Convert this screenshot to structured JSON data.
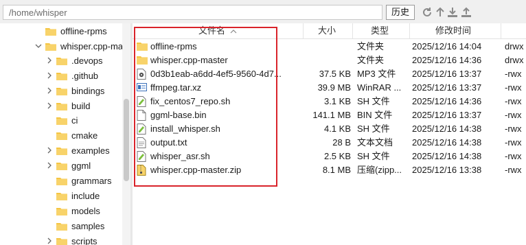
{
  "pathbar": {
    "path": "/home/whisper",
    "history_label": "历史",
    "tools": [
      "refresh-icon",
      "up-folder-icon",
      "download-icon",
      "upload-icon"
    ]
  },
  "tree": {
    "items": [
      {
        "label": "offline-rpms",
        "expanded": false,
        "has_children": false
      },
      {
        "label": "whisper.cpp-master",
        "expanded": true,
        "has_children": true
      },
      {
        "label": ".devops",
        "has_children": true
      },
      {
        "label": ".github",
        "has_children": true
      },
      {
        "label": "bindings",
        "has_children": true
      },
      {
        "label": "build",
        "has_children": true
      },
      {
        "label": "ci",
        "has_children": false
      },
      {
        "label": "cmake",
        "has_children": false
      },
      {
        "label": "examples",
        "has_children": true
      },
      {
        "label": "ggml",
        "has_children": true
      },
      {
        "label": "grammars",
        "has_children": false
      },
      {
        "label": "include",
        "has_children": false
      },
      {
        "label": "models",
        "has_children": false
      },
      {
        "label": "samples",
        "has_children": false
      },
      {
        "label": "scripts",
        "has_children": true
      }
    ]
  },
  "list": {
    "columns": {
      "name": "文件名",
      "size": "大小",
      "type": "类型",
      "modified": "修改时间"
    },
    "files": [
      {
        "name": "offline-rpms",
        "size": "",
        "type": "文件夹",
        "modified": "2025/12/16 14:04",
        "perm": "drwx",
        "icon": "folder-icon"
      },
      {
        "name": "whisper.cpp-master",
        "size": "",
        "type": "文件夹",
        "modified": "2025/12/16 14:36",
        "perm": "drwx",
        "icon": "folder-icon"
      },
      {
        "name": "0d3b1eab-a6dd-4ef5-9560-4d7...",
        "size": "37.5 KB",
        "type": "MP3 文件",
        "modified": "2025/12/16 13:37",
        "perm": "-rwx",
        "icon": "audio-file-icon"
      },
      {
        "name": "ffmpeg.tar.xz",
        "size": "39.9 MB",
        "type": "WinRAR ...",
        "modified": "2025/12/16 13:37",
        "perm": "-rwx",
        "icon": "archive-file-icon"
      },
      {
        "name": "fix_centos7_repo.sh",
        "size": "3.1 KB",
        "type": "SH 文件",
        "modified": "2025/12/16 14:36",
        "perm": "-rwx",
        "icon": "script-file-icon"
      },
      {
        "name": "ggml-base.bin",
        "size": "141.1 MB",
        "type": "BIN 文件",
        "modified": "2025/12/16 13:37",
        "perm": "-rwx",
        "icon": "blank-file-icon"
      },
      {
        "name": "install_whisper.sh",
        "size": "4.1 KB",
        "type": "SH 文件",
        "modified": "2025/12/16 14:38",
        "perm": "-rwx",
        "icon": "script-file-icon"
      },
      {
        "name": "output.txt",
        "size": "28 B",
        "type": "文本文档",
        "modified": "2025/12/16 14:38",
        "perm": "-rwx",
        "icon": "text-file-icon"
      },
      {
        "name": "whisper_asr.sh",
        "size": "2.5 KB",
        "type": "SH 文件",
        "modified": "2025/12/16 14:38",
        "perm": "-rwx",
        "icon": "script-file-icon"
      },
      {
        "name": "whisper.cpp-master.zip",
        "size": "8.1 MB",
        "type": "压缩(zipp...",
        "modified": "2025/12/16 13:38",
        "perm": "-rwx",
        "icon": "zip-file-icon"
      }
    ]
  },
  "colors": {
    "folder": "#f5c542",
    "highlight": "#d9232a",
    "accent": "#2a6fd6"
  }
}
